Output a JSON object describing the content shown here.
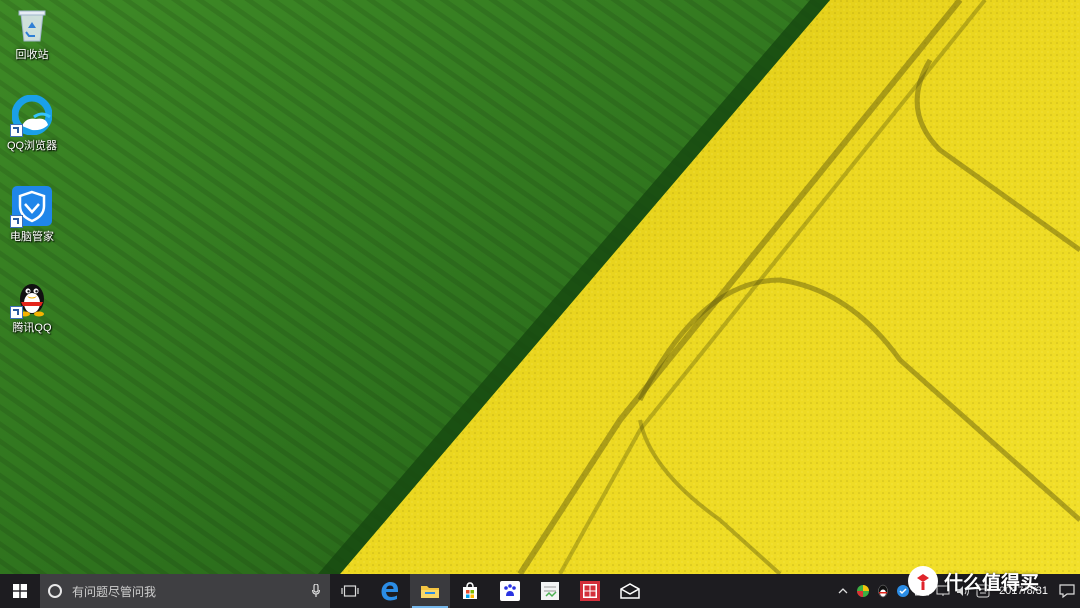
{
  "desktop": {
    "icons": [
      {
        "label": "回收站",
        "icon": "recycle-bin-icon"
      },
      {
        "label": "QQ浏览器",
        "icon": "qq-browser-icon"
      },
      {
        "label": "电脑管家",
        "icon": "pc-manager-icon"
      },
      {
        "label": "腾讯QQ",
        "icon": "qq-penguin-icon"
      }
    ]
  },
  "taskbar": {
    "search_placeholder": "有问题尽管问我",
    "pinned": [
      "edge-icon",
      "file-explorer-icon",
      "store-icon",
      "baidu-paw-icon",
      "notepad-app-icon",
      "red-grid-app-icon",
      "mail-icon"
    ],
    "clock": {
      "time": "",
      "date": "2017/8/31"
    }
  },
  "watermark": {
    "text": "什么值得买"
  },
  "colors": {
    "taskbar": "#1d1c20",
    "search": "#3f3f42",
    "accent": "#76b9ed",
    "field_green": "#2f7d1f",
    "field_yellow": "#e9d21a"
  }
}
